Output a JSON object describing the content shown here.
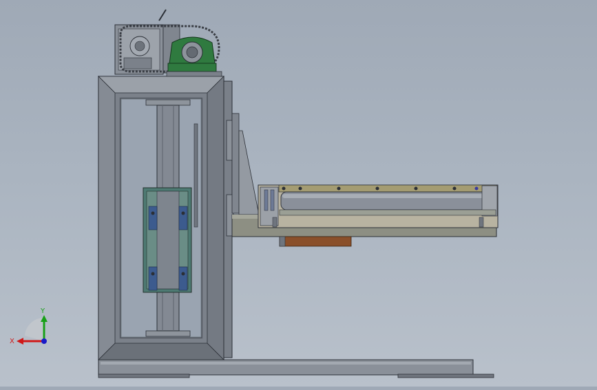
{
  "viewport": {
    "background_top": "#9fa9b6",
    "background_bottom": "#b9c1cb"
  },
  "model": {
    "view": "front",
    "components": [
      "frame",
      "inner-rail",
      "guide-block",
      "gearbox-drive",
      "pillow-block-bearing",
      "vertical-carriage-plate",
      "gusset",
      "fork-arm",
      "roller-conveyor",
      "base-plate",
      "counterweight-pad"
    ]
  },
  "triad": {
    "x_label": "X",
    "y_label": "Y",
    "x_color": "#d01818",
    "y_color": "#18a018",
    "z_color": "#1a1ac8"
  }
}
